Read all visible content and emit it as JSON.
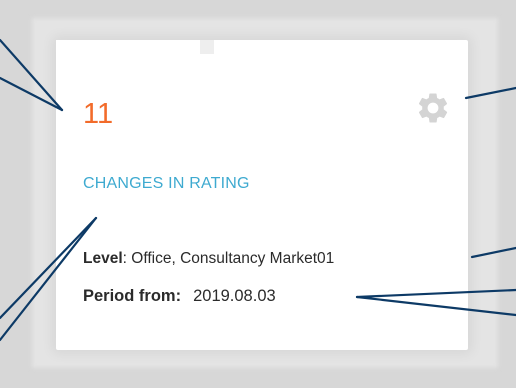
{
  "widget": {
    "count": "11",
    "title": "CHANGES IN RATING",
    "level_label": "Level",
    "level_value": "Office, Consultancy Market01",
    "period_label": "Period from:",
    "period_value": "2019.08.03"
  },
  "icons": {
    "settings": "gear-icon"
  },
  "colors": {
    "count": "#f26b2a",
    "title": "#3eaad0",
    "callout_line": "#0d3a66",
    "gear": "#d4d4d4"
  }
}
